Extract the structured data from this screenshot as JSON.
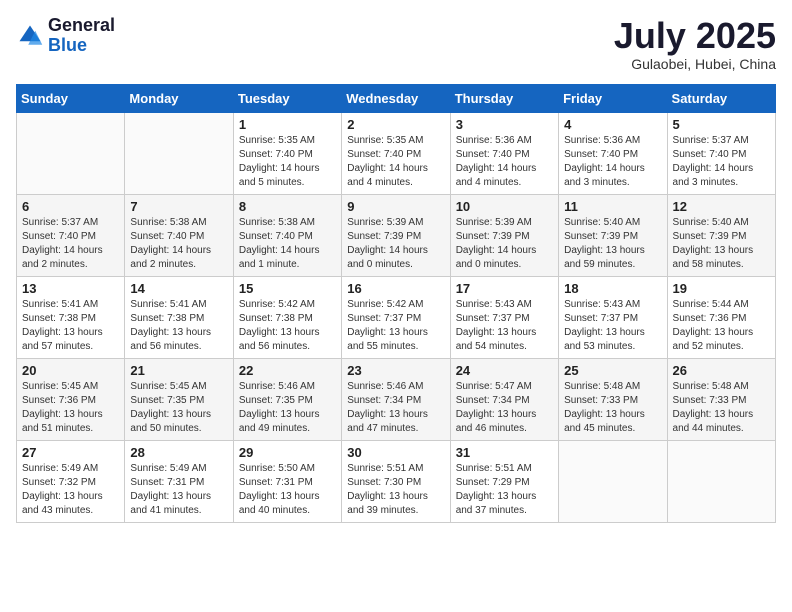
{
  "logo": {
    "general": "General",
    "blue": "Blue"
  },
  "header": {
    "month": "July 2025",
    "location": "Gulaobei, Hubei, China"
  },
  "days_of_week": [
    "Sunday",
    "Monday",
    "Tuesday",
    "Wednesday",
    "Thursday",
    "Friday",
    "Saturday"
  ],
  "weeks": [
    [
      {
        "day": "",
        "info": ""
      },
      {
        "day": "",
        "info": ""
      },
      {
        "day": "1",
        "info": "Sunrise: 5:35 AM\nSunset: 7:40 PM\nDaylight: 14 hours and 5 minutes."
      },
      {
        "day": "2",
        "info": "Sunrise: 5:35 AM\nSunset: 7:40 PM\nDaylight: 14 hours and 4 minutes."
      },
      {
        "day": "3",
        "info": "Sunrise: 5:36 AM\nSunset: 7:40 PM\nDaylight: 14 hours and 4 minutes."
      },
      {
        "day": "4",
        "info": "Sunrise: 5:36 AM\nSunset: 7:40 PM\nDaylight: 14 hours and 3 minutes."
      },
      {
        "day": "5",
        "info": "Sunrise: 5:37 AM\nSunset: 7:40 PM\nDaylight: 14 hours and 3 minutes."
      }
    ],
    [
      {
        "day": "6",
        "info": "Sunrise: 5:37 AM\nSunset: 7:40 PM\nDaylight: 14 hours and 2 minutes."
      },
      {
        "day": "7",
        "info": "Sunrise: 5:38 AM\nSunset: 7:40 PM\nDaylight: 14 hours and 2 minutes."
      },
      {
        "day": "8",
        "info": "Sunrise: 5:38 AM\nSunset: 7:40 PM\nDaylight: 14 hours and 1 minute."
      },
      {
        "day": "9",
        "info": "Sunrise: 5:39 AM\nSunset: 7:39 PM\nDaylight: 14 hours and 0 minutes."
      },
      {
        "day": "10",
        "info": "Sunrise: 5:39 AM\nSunset: 7:39 PM\nDaylight: 14 hours and 0 minutes."
      },
      {
        "day": "11",
        "info": "Sunrise: 5:40 AM\nSunset: 7:39 PM\nDaylight: 13 hours and 59 minutes."
      },
      {
        "day": "12",
        "info": "Sunrise: 5:40 AM\nSunset: 7:39 PM\nDaylight: 13 hours and 58 minutes."
      }
    ],
    [
      {
        "day": "13",
        "info": "Sunrise: 5:41 AM\nSunset: 7:38 PM\nDaylight: 13 hours and 57 minutes."
      },
      {
        "day": "14",
        "info": "Sunrise: 5:41 AM\nSunset: 7:38 PM\nDaylight: 13 hours and 56 minutes."
      },
      {
        "day": "15",
        "info": "Sunrise: 5:42 AM\nSunset: 7:38 PM\nDaylight: 13 hours and 56 minutes."
      },
      {
        "day": "16",
        "info": "Sunrise: 5:42 AM\nSunset: 7:37 PM\nDaylight: 13 hours and 55 minutes."
      },
      {
        "day": "17",
        "info": "Sunrise: 5:43 AM\nSunset: 7:37 PM\nDaylight: 13 hours and 54 minutes."
      },
      {
        "day": "18",
        "info": "Sunrise: 5:43 AM\nSunset: 7:37 PM\nDaylight: 13 hours and 53 minutes."
      },
      {
        "day": "19",
        "info": "Sunrise: 5:44 AM\nSunset: 7:36 PM\nDaylight: 13 hours and 52 minutes."
      }
    ],
    [
      {
        "day": "20",
        "info": "Sunrise: 5:45 AM\nSunset: 7:36 PM\nDaylight: 13 hours and 51 minutes."
      },
      {
        "day": "21",
        "info": "Sunrise: 5:45 AM\nSunset: 7:35 PM\nDaylight: 13 hours and 50 minutes."
      },
      {
        "day": "22",
        "info": "Sunrise: 5:46 AM\nSunset: 7:35 PM\nDaylight: 13 hours and 49 minutes."
      },
      {
        "day": "23",
        "info": "Sunrise: 5:46 AM\nSunset: 7:34 PM\nDaylight: 13 hours and 47 minutes."
      },
      {
        "day": "24",
        "info": "Sunrise: 5:47 AM\nSunset: 7:34 PM\nDaylight: 13 hours and 46 minutes."
      },
      {
        "day": "25",
        "info": "Sunrise: 5:48 AM\nSunset: 7:33 PM\nDaylight: 13 hours and 45 minutes."
      },
      {
        "day": "26",
        "info": "Sunrise: 5:48 AM\nSunset: 7:33 PM\nDaylight: 13 hours and 44 minutes."
      }
    ],
    [
      {
        "day": "27",
        "info": "Sunrise: 5:49 AM\nSunset: 7:32 PM\nDaylight: 13 hours and 43 minutes."
      },
      {
        "day": "28",
        "info": "Sunrise: 5:49 AM\nSunset: 7:31 PM\nDaylight: 13 hours and 41 minutes."
      },
      {
        "day": "29",
        "info": "Sunrise: 5:50 AM\nSunset: 7:31 PM\nDaylight: 13 hours and 40 minutes."
      },
      {
        "day": "30",
        "info": "Sunrise: 5:51 AM\nSunset: 7:30 PM\nDaylight: 13 hours and 39 minutes."
      },
      {
        "day": "31",
        "info": "Sunrise: 5:51 AM\nSunset: 7:29 PM\nDaylight: 13 hours and 37 minutes."
      },
      {
        "day": "",
        "info": ""
      },
      {
        "day": "",
        "info": ""
      }
    ]
  ]
}
